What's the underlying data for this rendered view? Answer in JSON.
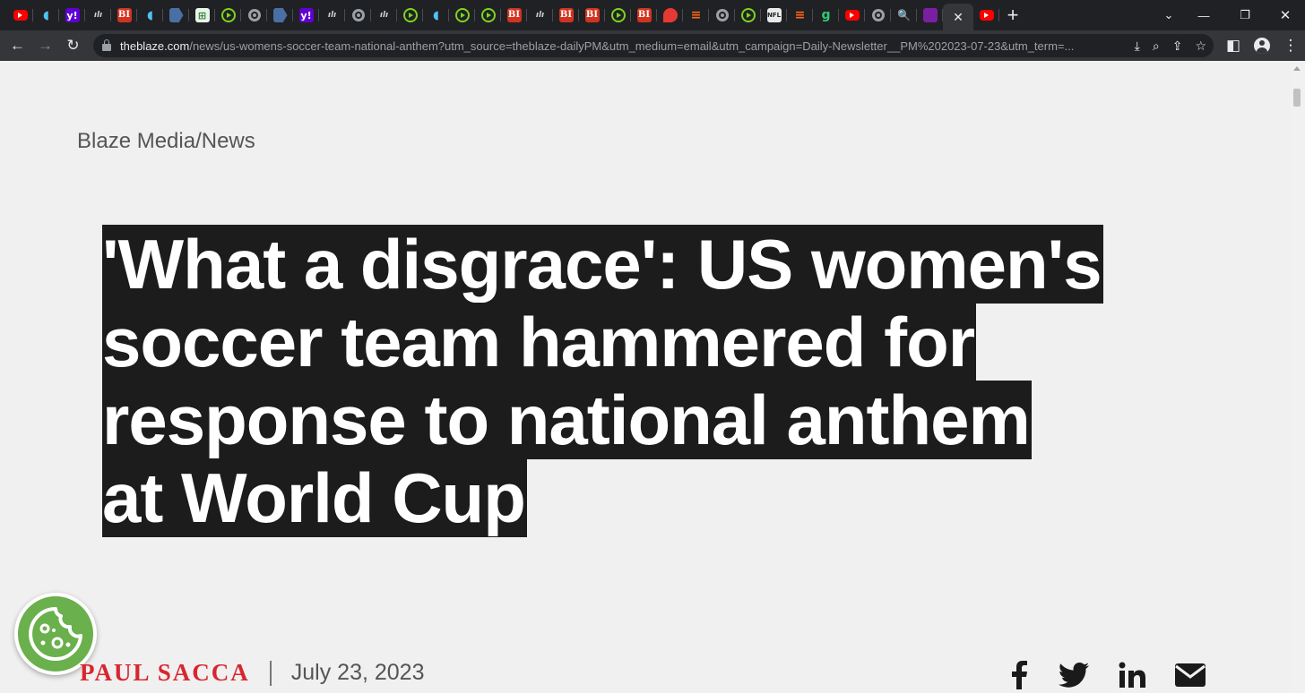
{
  "browser": {
    "tabs": [
      {
        "icon": "youtube-icon"
      },
      {
        "icon": "shield-icon"
      },
      {
        "icon": "yahoo-icon",
        "text": "y!"
      },
      {
        "icon": "site-icon",
        "text": "ılı"
      },
      {
        "icon": "bi-icon",
        "text": "BI"
      },
      {
        "icon": "shield-icon"
      },
      {
        "icon": "arrow-icon"
      },
      {
        "icon": "grid-icon",
        "text": "⊞"
      },
      {
        "icon": "play-icon"
      },
      {
        "icon": "globe-icon"
      },
      {
        "icon": "arrow-icon"
      },
      {
        "icon": "yahoo-icon",
        "text": "y!"
      },
      {
        "icon": "site-icon",
        "text": "ılı"
      },
      {
        "icon": "globe-icon"
      },
      {
        "icon": "site-icon",
        "text": "ılı"
      },
      {
        "icon": "play-icon"
      },
      {
        "icon": "shield-icon"
      },
      {
        "icon": "play-icon"
      },
      {
        "icon": "play-icon"
      },
      {
        "icon": "bi-icon",
        "text": "BI"
      },
      {
        "icon": "site-icon",
        "text": "ılı"
      },
      {
        "icon": "bi-icon",
        "text": "BI"
      },
      {
        "icon": "bi-icon",
        "text": "BI"
      },
      {
        "icon": "play-icon"
      },
      {
        "icon": "bi-icon",
        "text": "BI"
      },
      {
        "icon": "pin-icon"
      },
      {
        "icon": "substack-icon",
        "text": "≡"
      },
      {
        "icon": "globe-icon"
      },
      {
        "icon": "play-icon"
      },
      {
        "icon": "nfl-icon",
        "text": "NFL"
      },
      {
        "icon": "substack-icon",
        "text": "≡"
      },
      {
        "icon": "g-icon",
        "text": "g"
      },
      {
        "icon": "youtube-icon"
      },
      {
        "icon": "globe-icon"
      },
      {
        "icon": "search-icon",
        "text": "🔍"
      },
      {
        "icon": "mail-icon"
      }
    ],
    "active_tab_close": "✕",
    "after_active": {
      "icon": "youtube-icon"
    },
    "new_tab": "+",
    "url_host": "theblaze.com",
    "url_path": "/news/us-womens-soccer-team-national-anthem?utm_source=theblaze-dailyPM&utm_medium=email&utm_campaign=Daily-Newsletter__PM%202023-07-23&utm_term=..."
  },
  "page": {
    "breadcrumb": "Blaze Media/News",
    "headline": "'What a disgrace': US women's soccer team hammered for response to national anthem at World Cup",
    "author": "PAUL SACCA",
    "date": "July 23, 2023",
    "share": [
      "facebook-icon",
      "twitter-icon",
      "linkedin-icon",
      "email-icon"
    ]
  },
  "colors": {
    "accent": "#d8262f",
    "headline_bg": "#1c1c1c",
    "cookie": "#6ab04c"
  }
}
